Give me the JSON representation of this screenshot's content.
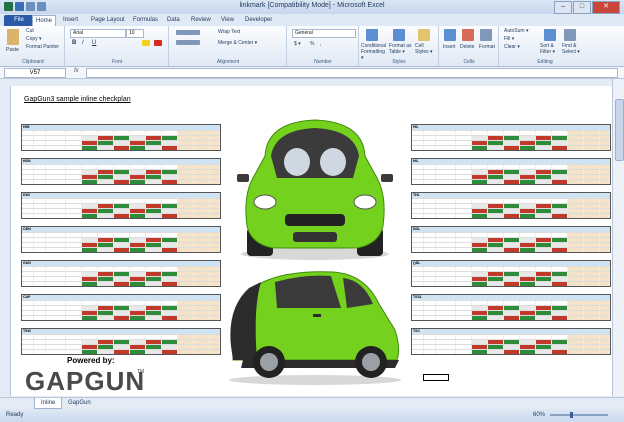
{
  "window": {
    "title": "linkmark  [Compatibility Mode]  -  Microsoft Excel",
    "controls": [
      "–",
      "□",
      "✕"
    ]
  },
  "ribbon_tabs": [
    "File",
    "Home",
    "Insert",
    "Page Layout",
    "Formulas",
    "Data",
    "Review",
    "View",
    "Developer"
  ],
  "ribbon": {
    "clipboard": {
      "label": "Clipboard",
      "paste": "Paste",
      "cut": "Cut",
      "copy": "Copy ▾",
      "format_painter": "Format Painter"
    },
    "font": {
      "label": "Font",
      "family": "Arial",
      "size": "10",
      "bold": "B",
      "italic": "I",
      "underline": "U"
    },
    "alignment": {
      "label": "Alignment",
      "wrap": "Wrap Text",
      "merge": "Merge & Center ▾"
    },
    "number": {
      "label": "Number",
      "format": "General",
      "currency": "$ ▾",
      "percent": "%",
      "comma": ","
    },
    "styles": {
      "label": "Styles",
      "conditional": "Conditional Formatting ▾",
      "format_table": "Format as Table ▾",
      "cell_styles": "Cell Styles ▾"
    },
    "cells": {
      "label": "Cells",
      "insert": "Insert",
      "delete": "Delete",
      "format": "Format"
    },
    "editing": {
      "label": "Editing",
      "autosum": "AutoSum ▾",
      "fill": "Fill ▾",
      "clear": "Clear ▾",
      "sort": "Sort & Filter ▾",
      "find": "Find & Select ▾"
    }
  },
  "formula_bar": {
    "name_box": "V57",
    "fx": "fx",
    "value": ""
  },
  "sheet": {
    "title": "GapGun3 sample inline checkplan",
    "powered_by": "Powered by:",
    "brand": "GAPGUN",
    "brand_tm": "TM",
    "left_tables": [
      "HIM",
      "HDN",
      "DWI",
      "ODN",
      "GUN",
      "CAP",
      "TSW"
    ],
    "right_tables": [
      "HIL",
      "HIL",
      "THL",
      "DDL",
      "QDL",
      "TSSL",
      "TSC"
    ]
  },
  "sheet_tabs": [
    "Inline",
    "GapGun"
  ],
  "status": {
    "ready": "Ready",
    "zoom": "60%"
  },
  "colors": {
    "accent": "#2a5aa8",
    "car_green": "#6fcf1f",
    "cell_red": "#c0392b",
    "cell_green": "#2e8b3a",
    "header_blue": "#cfe3f3",
    "header_tan": "#f4e3c8"
  }
}
